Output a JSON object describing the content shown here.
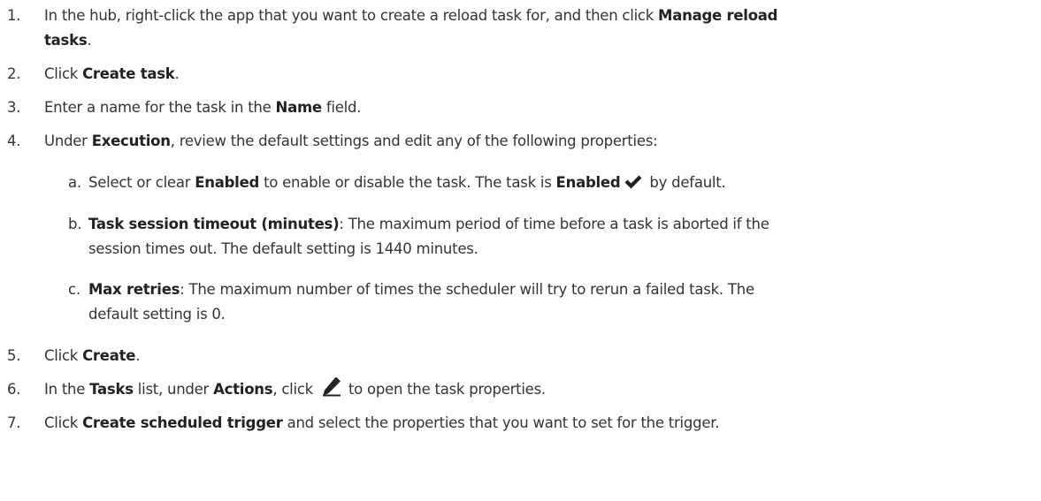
{
  "steps": [
    {
      "num": "1.",
      "line1_pre": "In the hub, right-click the app that you want to create a reload task for, and then click ",
      "line1_bold": "Manage reload",
      "line2_bold": "tasks",
      "line2_post": "."
    },
    {
      "num": "2.",
      "pre": "Click ",
      "bold": "Create task",
      "post": "."
    },
    {
      "num": "3.",
      "pre": "Enter a name for the task in the ",
      "bold": "Name",
      "post": " field."
    },
    {
      "num": "4.",
      "pre": "Under ",
      "bold": "Execution",
      "post": ", review the default settings and edit any of the following properties:"
    },
    {
      "num": "5.",
      "pre": "Click ",
      "bold": "Create",
      "post": "."
    },
    {
      "num": "6.",
      "pre": "In the ",
      "bold1": "Tasks",
      "mid": " list, under ",
      "bold2": "Actions",
      "mid2": ", click ",
      "icon": "pencil-icon",
      "post": " to open the task properties."
    },
    {
      "num": "7.",
      "pre": "Click ",
      "bold": "Create scheduled trigger",
      "post": " and select the properties that you want to set for the trigger."
    }
  ],
  "substeps": [
    {
      "num": "a.",
      "pre": "Select or clear ",
      "bold1": "Enabled",
      "mid": " to enable or disable the task. The task is ",
      "bold2": "Enabled",
      "icon": "checkmark-icon",
      "post": " by default."
    },
    {
      "num": "b.",
      "bold": "Task session timeout (minutes)",
      "line1_post": ": The maximum period of time before a task is aborted if the",
      "line2": "session times out. The default setting is 1440 minutes."
    },
    {
      "num": "c.",
      "bold": "Max retries",
      "line1_post": ": The maximum number of times the scheduler will try to rerun a failed task. The",
      "line2": "default setting is 0."
    }
  ]
}
